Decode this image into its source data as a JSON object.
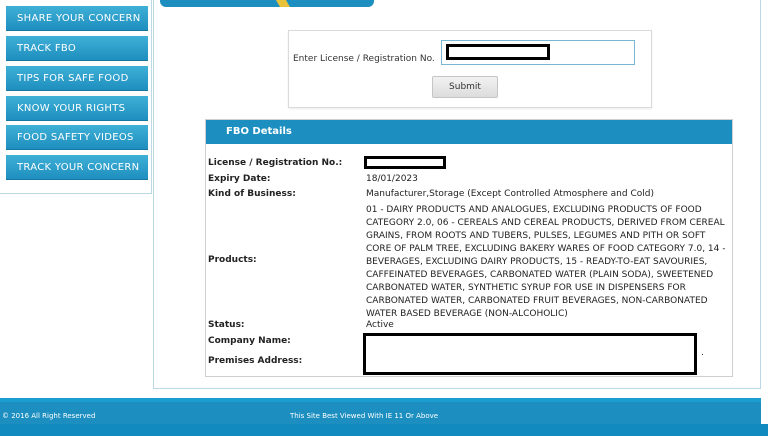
{
  "menu": {
    "items": [
      {
        "label": "SHARE YOUR CONCERN"
      },
      {
        "label": "TRACK FBO"
      },
      {
        "label": "TIPS FOR SAFE FOOD"
      },
      {
        "label": "KNOW YOUR RIGHTS"
      },
      {
        "label": "FOOD SAFETY VIDEOS"
      },
      {
        "label": "TRACK YOUR CONCERN"
      }
    ]
  },
  "search": {
    "label": "Enter License / Registration No.",
    "value": "",
    "submit_label": "Submit"
  },
  "details": {
    "title": "FBO Details",
    "license_label": "License / Registration No.:",
    "expiry_label": "Expiry Date:",
    "expiry_value": "18/01/2023",
    "business_label": "Kind of Business:",
    "business_value": "Manufacturer,Storage (Except Controlled Atmosphere and Cold)",
    "products_label": "Products:",
    "products_value": "01 - DAIRY PRODUCTS AND ANALOGUES, EXCLUDING PRODUCTS OF FOOD CATEGORY 2.0, 06 - CEREALS AND CEREAL PRODUCTS, DERIVED FROM CEREAL GRAINS, FROM ROOTS AND TUBERS, PULSES, LEGUMES AND PITH OR SOFT CORE OF PALM TREE, EXCLUDING BAKERY WARES OF FOOD CATEGORY 7.0, 14 - BEVERAGES, EXCLUDING DAIRY PRODUCTS, 15 - READY-TO-EAT SAVOURIES, CAFFEINATED BEVERAGES, CARBONATED WATER (PLAIN SODA), SWEETENED CARBONATED WATER, SYNTHETIC SYRUP FOR USE IN DISPENSERS FOR CARBONATED WATER, CARBONATED FRUIT BEVERAGES, NON-CARBONATED WATER BASED BEVERAGE (NON-ALCOHOLIC)",
    "status_label": "Status:",
    "status_value": "Active",
    "company_label": "Company Name:",
    "premises_label": "Premises Address:",
    "trailing_dot": "."
  },
  "footer": {
    "copyright": "© 2016 All Right Reserved",
    "browser_note": "This Site Best Viewed With IE 11 Or Above"
  },
  "colors": {
    "accent": "#1c8fc0",
    "menu_button": "#2b9fcb"
  }
}
